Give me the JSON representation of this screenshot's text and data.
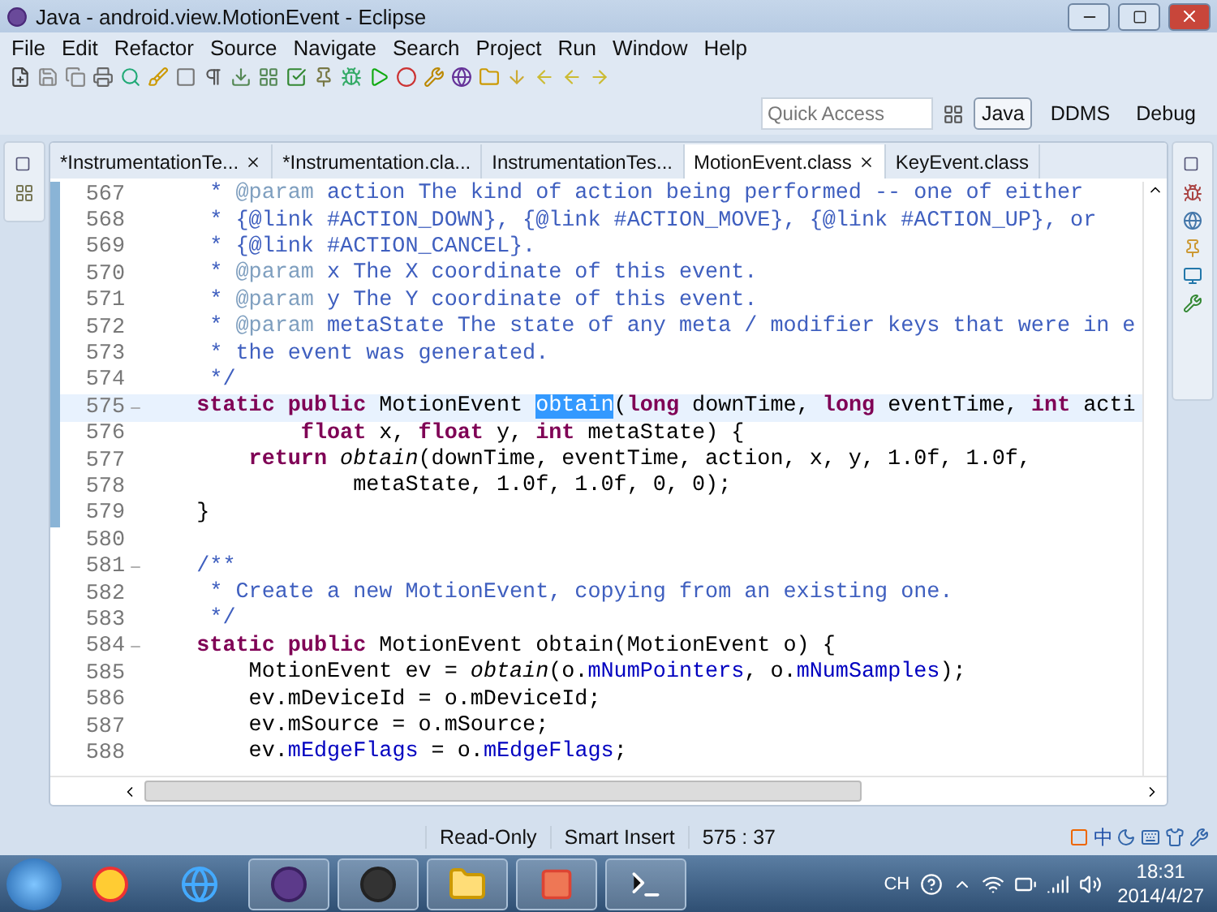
{
  "window": {
    "title": "Java - android.view.MotionEvent - Eclipse"
  },
  "menu": [
    "File",
    "Edit",
    "Refactor",
    "Source",
    "Navigate",
    "Search",
    "Project",
    "Run",
    "Window",
    "Help"
  ],
  "quick_access": {
    "placeholder": "Quick Access"
  },
  "perspectives": [
    {
      "label": "Java",
      "selected": true
    },
    {
      "label": "DDMS",
      "selected": false
    },
    {
      "label": "Debug",
      "selected": false
    }
  ],
  "tabs": [
    {
      "label": "*InstrumentationTe...",
      "selected": false,
      "closable": true
    },
    {
      "label": "*Instrumentation.cla...",
      "selected": false,
      "closable": false
    },
    {
      "label": "InstrumentationTes...",
      "selected": false,
      "closable": false
    },
    {
      "label": "MotionEvent.class",
      "selected": true,
      "closable": true
    },
    {
      "label": "KeyEvent.class",
      "selected": false,
      "closable": false
    }
  ],
  "editor": {
    "lines": [
      {
        "number": "567",
        "current": false,
        "foldable": false,
        "marked": true,
        "tokens": [
          {
            "kind": "comment",
            "text": "     * "
          },
          {
            "kind": "tag",
            "text": "@param"
          },
          {
            "kind": "comment",
            "text": " action The kind of action being performed -- one of either"
          }
        ]
      },
      {
        "number": "568",
        "current": false,
        "foldable": false,
        "marked": true,
        "tokens": [
          {
            "kind": "comment",
            "text": "     * {@link #ACTION_DOWN}, {@link #ACTION_MOVE}, {@link #ACTION_UP}, or"
          }
        ]
      },
      {
        "number": "569",
        "current": false,
        "foldable": false,
        "marked": true,
        "tokens": [
          {
            "kind": "comment",
            "text": "     * {@link #ACTION_CANCEL}."
          }
        ]
      },
      {
        "number": "570",
        "current": false,
        "foldable": false,
        "marked": true,
        "tokens": [
          {
            "kind": "comment",
            "text": "     * "
          },
          {
            "kind": "tag",
            "text": "@param"
          },
          {
            "kind": "comment",
            "text": " x The X coordinate of this event."
          }
        ]
      },
      {
        "number": "571",
        "current": false,
        "foldable": false,
        "marked": true,
        "tokens": [
          {
            "kind": "comment",
            "text": "     * "
          },
          {
            "kind": "tag",
            "text": "@param"
          },
          {
            "kind": "comment",
            "text": " y The Y coordinate of this event."
          }
        ]
      },
      {
        "number": "572",
        "current": false,
        "foldable": false,
        "marked": true,
        "tokens": [
          {
            "kind": "comment",
            "text": "     * "
          },
          {
            "kind": "tag",
            "text": "@param"
          },
          {
            "kind": "comment",
            "text": " metaState The state of any meta / modifier keys that were in e"
          }
        ]
      },
      {
        "number": "573",
        "current": false,
        "foldable": false,
        "marked": true,
        "tokens": [
          {
            "kind": "comment",
            "text": "     * the event was generated."
          }
        ]
      },
      {
        "number": "574",
        "current": false,
        "foldable": false,
        "marked": true,
        "tokens": [
          {
            "kind": "comment",
            "text": "     */"
          }
        ]
      },
      {
        "number": "575",
        "current": true,
        "foldable": true,
        "marked": true,
        "tokens": [
          {
            "kind": "keyword",
            "text": "    static public"
          },
          {
            "kind": "plain",
            "text": " MotionEvent "
          },
          {
            "kind": "selected",
            "text": "obtain"
          },
          {
            "kind": "plain",
            "text": "("
          },
          {
            "kind": "keyword",
            "text": "long"
          },
          {
            "kind": "plain",
            "text": " downTime, "
          },
          {
            "kind": "keyword",
            "text": "long"
          },
          {
            "kind": "plain",
            "text": " eventTime, "
          },
          {
            "kind": "keyword",
            "text": "int"
          },
          {
            "kind": "plain",
            "text": " acti"
          }
        ]
      },
      {
        "number": "576",
        "current": false,
        "foldable": false,
        "marked": true,
        "tokens": [
          {
            "kind": "keyword",
            "text": "            float"
          },
          {
            "kind": "plain",
            "text": " x, "
          },
          {
            "kind": "keyword",
            "text": "float"
          },
          {
            "kind": "plain",
            "text": " y, "
          },
          {
            "kind": "keyword",
            "text": "int"
          },
          {
            "kind": "plain",
            "text": " metaState) {"
          }
        ]
      },
      {
        "number": "577",
        "current": false,
        "foldable": false,
        "marked": true,
        "tokens": [
          {
            "kind": "keyword",
            "text": "        return"
          },
          {
            "kind": "italic",
            "text": " obtain"
          },
          {
            "kind": "plain",
            "text": "(downTime, eventTime, action, x, y, 1.0f, 1.0f,"
          }
        ]
      },
      {
        "number": "578",
        "current": false,
        "foldable": false,
        "marked": true,
        "tokens": [
          {
            "kind": "plain",
            "text": "                metaState, 1.0f, 1.0f, 0, 0);"
          }
        ]
      },
      {
        "number": "579",
        "current": false,
        "foldable": false,
        "marked": true,
        "tokens": [
          {
            "kind": "plain",
            "text": "    }"
          }
        ]
      },
      {
        "number": "580",
        "current": false,
        "foldable": false,
        "marked": false
      },
      {
        "number": "581",
        "current": false,
        "foldable": true,
        "marked": false,
        "tokens": [
          {
            "kind": "comment",
            "text": "    /**"
          }
        ]
      },
      {
        "number": "582",
        "current": false,
        "foldable": false,
        "marked": false,
        "tokens": [
          {
            "kind": "comment",
            "text": "     * Create a new MotionEvent, copying from an existing one."
          }
        ]
      },
      {
        "number": "583",
        "current": false,
        "foldable": false,
        "marked": false,
        "tokens": [
          {
            "kind": "comment",
            "text": "     */"
          }
        ]
      },
      {
        "number": "584",
        "current": false,
        "foldable": true,
        "marked": false,
        "tokens": [
          {
            "kind": "keyword",
            "text": "    static public"
          },
          {
            "kind": "plain",
            "text": " MotionEvent obtain(MotionEvent o) {"
          }
        ]
      },
      {
        "number": "585",
        "current": false,
        "foldable": false,
        "marked": false,
        "tokens": [
          {
            "kind": "plain",
            "text": "        MotionEvent ev = "
          },
          {
            "kind": "italic",
            "text": "obtain"
          },
          {
            "kind": "plain",
            "text": "(o."
          },
          {
            "kind": "field",
            "text": "mNumPointers"
          },
          {
            "kind": "plain",
            "text": ", o."
          },
          {
            "kind": "field",
            "text": "mNumSamples"
          },
          {
            "kind": "plain",
            "text": ");"
          }
        ]
      },
      {
        "number": "586",
        "current": false,
        "foldable": false,
        "marked": false,
        "tokens": [
          {
            "kind": "plain",
            "text": "        ev.mDeviceId = o.mDeviceId;"
          }
        ]
      },
      {
        "number": "587",
        "current": false,
        "foldable": false,
        "marked": false,
        "tokens": [
          {
            "kind": "plain",
            "text": "        ev.mSource = o.mSource;"
          }
        ]
      },
      {
        "number": "588",
        "current": false,
        "foldable": false,
        "marked": false,
        "tokens": [
          {
            "kind": "plain",
            "text": "        ev."
          },
          {
            "kind": "field",
            "text": "mEdgeFlags"
          },
          {
            "kind": "plain",
            "text": " = o."
          },
          {
            "kind": "field",
            "text": "mEdgeFlags"
          },
          {
            "kind": "plain",
            "text": ";"
          }
        ]
      }
    ]
  },
  "status_bar": [
    "Read-Only",
    "Smart Insert",
    "575 : 37"
  ],
  "ime_bar": {
    "language": "中"
  },
  "taskbar": {
    "tray_language": "CH",
    "time": "18:31",
    "date": "2014/4/27"
  }
}
